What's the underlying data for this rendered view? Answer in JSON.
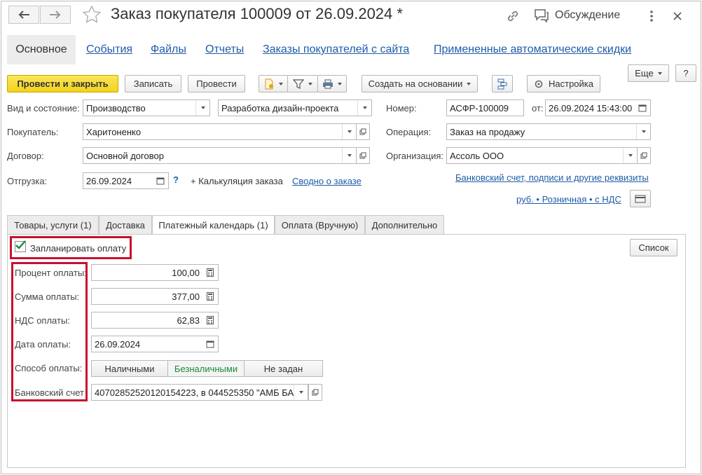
{
  "window": {
    "title": "Заказ покупателя 100009 от 26.09.2024 *",
    "discussion_label": "Обсуждение",
    "more_icon": "kebab-icon",
    "close_icon": "close-icon"
  },
  "section_tabs": [
    {
      "label": "Основное",
      "active": true
    },
    {
      "label": "События"
    },
    {
      "label": "Файлы"
    },
    {
      "label": "Отчеты"
    },
    {
      "label": "Заказы покупателей с сайта"
    },
    {
      "label": "Примененные автоматические скидки"
    }
  ],
  "toolbar": {
    "post_close": "Провести и закрыть",
    "save": "Записать",
    "post": "Провести",
    "create_based": "Создать на основании",
    "settings": "Настройка",
    "more": "Еще",
    "help": "?"
  },
  "header": {
    "kind_label": "Вид и состояние:",
    "kind_value": "Производство",
    "state_value": "Разработка дизайн-проекта",
    "number_label": "Номер:",
    "number_value": "АСФР-100009",
    "date_label": "от:",
    "date_value": "26.09.2024 15:43:00",
    "buyer_label": "Покупатель:",
    "buyer_value": "Харитоненко",
    "operation_label": "Операция:",
    "operation_value": "Заказ на продажу",
    "contract_label": "Договор:",
    "contract_value": "Основной договор",
    "org_label": "Организация:",
    "org_value": "Ассоль ООО",
    "shipment_label": "Отгрузка:",
    "shipment_value": "26.09.2024",
    "help_mark": "?",
    "calc_link": "+ Калькуляция заказа",
    "summary_link": "Сводно о заказе",
    "bank_link": "Банковский счет, подписи и другие реквизиты",
    "price_link": "руб. • Розничная • с НДС"
  },
  "inner_tabs": [
    {
      "label": "Товары, услуги (1)"
    },
    {
      "label": "Доставка"
    },
    {
      "label": "Платежный календарь (1)",
      "active": true
    },
    {
      "label": "Оплата (Вручную)"
    },
    {
      "label": "Дополнительно"
    }
  ],
  "payment": {
    "plan_checkbox_label": "Запланировать оплату",
    "plan_checked": true,
    "list_button": "Список",
    "percent_label": "Процент оплаты:",
    "percent_value": "100,00",
    "sum_label": "Сумма оплаты:",
    "sum_value": "377,00",
    "vat_label": "НДС оплаты:",
    "vat_value": "62,83",
    "date_label": "Дата оплаты:",
    "date_value": "26.09.2024",
    "method_label": "Способ оплаты:",
    "methods": [
      {
        "label": "Наличными"
      },
      {
        "label": "Безналичными",
        "selected": true
      },
      {
        "label": "Не задан"
      }
    ],
    "bank_label": "Банковский счет",
    "bank_value": "40702852520120154223, в 044525350 \"АМБ БА"
  },
  "colors": {
    "accent_yellow": "#f2d31c",
    "link_blue": "#1f5ca8",
    "highlight_red": "#c8102e",
    "selected_green": "#1a8a3a"
  }
}
